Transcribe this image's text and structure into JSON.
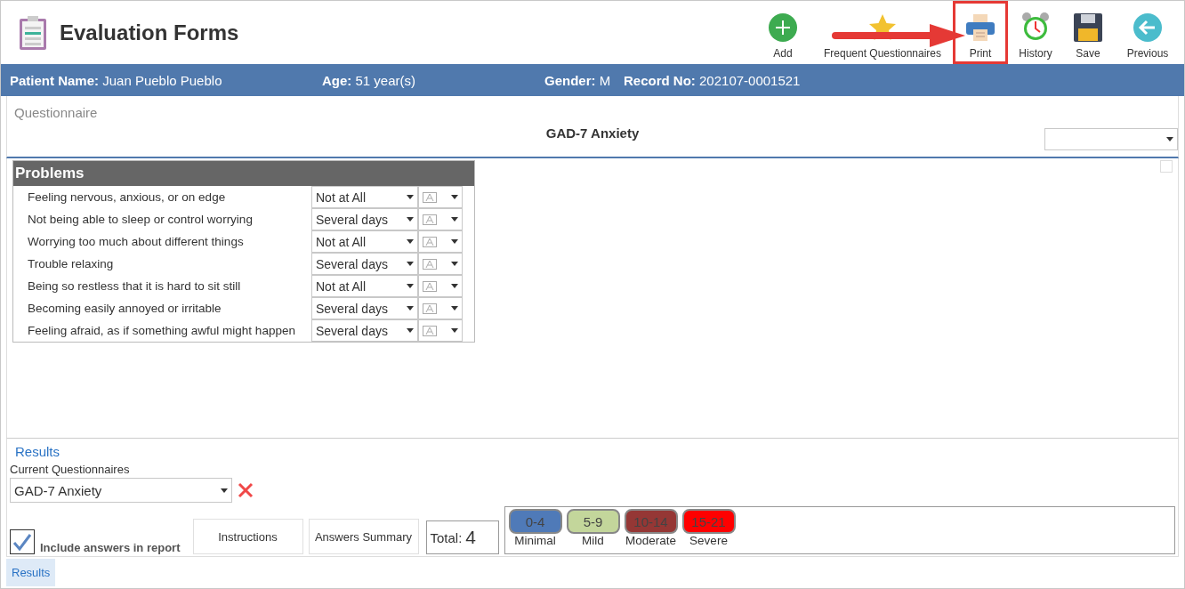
{
  "header": {
    "title": "Evaluation Forms"
  },
  "toolbar": [
    {
      "kind": "add",
      "label": "Add",
      "highlighted": false
    },
    {
      "kind": "star",
      "label": "Frequent Questionnaires",
      "highlighted": false
    },
    {
      "kind": "print",
      "label": "Print",
      "highlighted": true
    },
    {
      "kind": "history",
      "label": "History",
      "highlighted": false
    },
    {
      "kind": "save",
      "label": "Save",
      "highlighted": false
    },
    {
      "kind": "previous",
      "label": "Previous",
      "highlighted": false
    }
  ],
  "patient": [
    {
      "label": "Patient Name:",
      "value": "Juan Pueblo Pueblo"
    },
    {
      "label": "Age:",
      "value": "51 year(s)"
    },
    {
      "label": "Gender:",
      "value": "M"
    },
    {
      "label": "Record No:",
      "value": "202107-0001521"
    }
  ],
  "questionnaire": {
    "label": "Questionnaire",
    "title": "GAD-7 Anxiety"
  },
  "problems": {
    "title": "Problems",
    "rows": [
      {
        "question": "Feeling nervous, anxious, or on edge",
        "answer": "Not at All"
      },
      {
        "question": "Not being able to sleep or control worrying",
        "answer": "Several days"
      },
      {
        "question": "Worrying too much about different things",
        "answer": "Not at All"
      },
      {
        "question": "Trouble relaxing",
        "answer": "Several days"
      },
      {
        "question": "Being so restless that it is hard to sit still",
        "answer": "Not at All"
      },
      {
        "question": "Becoming easily annoyed or irritable",
        "answer": "Several days"
      },
      {
        "question": "Feeling afraid, as if something awful might happen",
        "answer": "Several days"
      }
    ]
  },
  "results": {
    "heading": "Results",
    "current_label": "Current Questionnaires",
    "current_value": "GAD-7 Anxiety",
    "include_answers": {
      "label": "Include answers in report",
      "checked": true
    },
    "buttons": [
      "Instructions",
      "Answers Summary"
    ],
    "total_label": "Total:",
    "total_value": "4",
    "legend": [
      {
        "range": "0-4",
        "label": "Minimal",
        "color": "#4f7ab8"
      },
      {
        "range": "5-9",
        "label": "Mild",
        "color": "#c3d69b"
      },
      {
        "range": "10-14",
        "label": "Moderate",
        "color": "#953735"
      },
      {
        "range": "15-21",
        "label": "Severe",
        "color": "#ff0000"
      }
    ]
  },
  "tabs": [
    {
      "label": "Results",
      "selected": true
    }
  ]
}
